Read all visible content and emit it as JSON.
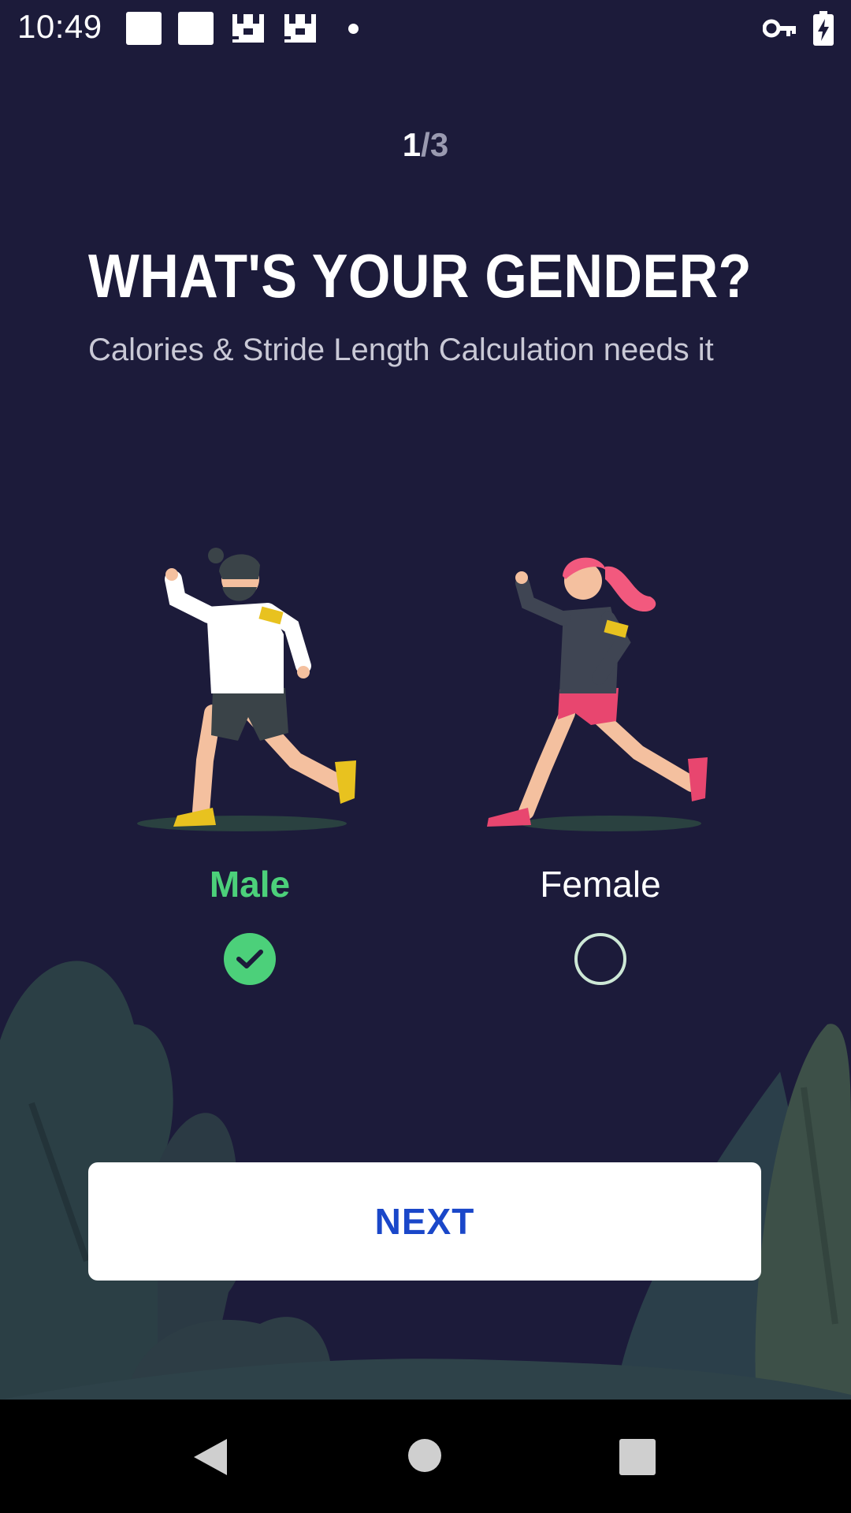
{
  "status_bar": {
    "time": "10:49",
    "icons": [
      "notification-square-icon",
      "notification-square-icon",
      "pixel-app-icon",
      "pixel-app-icon",
      "dot-icon",
      "vpn-key-icon",
      "battery-charging-icon"
    ]
  },
  "progress": {
    "current": "1",
    "separator": "/",
    "total": "3"
  },
  "title": "WHAT'S YOUR GENDER?",
  "subtitle": "Calories & Stride Length Calculation needs it",
  "options": {
    "male": {
      "label": "Male",
      "selected": true
    },
    "female": {
      "label": "Female",
      "selected": false
    }
  },
  "next_button": {
    "label": "NEXT"
  },
  "colors": {
    "background": "#1c1b3a",
    "accent_green": "#4cd07a",
    "button_text": "#1a47c9",
    "foliage": "#2b3f45"
  },
  "nav_bar": {
    "icons": [
      "back-icon",
      "home-icon",
      "recents-icon"
    ]
  }
}
